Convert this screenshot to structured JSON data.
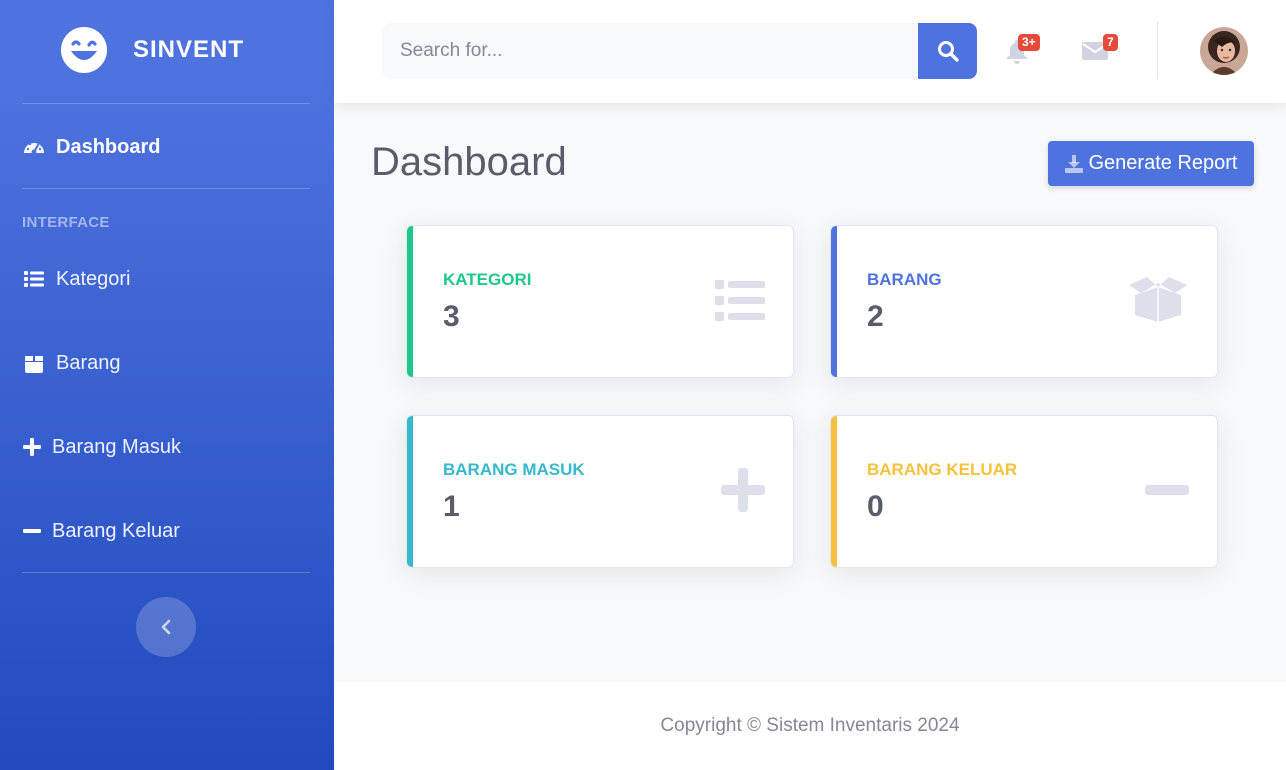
{
  "brand": {
    "name": "SINVENT"
  },
  "sidebar": {
    "active_item": {
      "label": "Dashboard",
      "icon": "tachometer-icon"
    },
    "heading": "INTERFACE",
    "items": [
      {
        "label": "Kategori",
        "icon": "list-icon"
      },
      {
        "label": "Barang",
        "icon": "box-icon"
      },
      {
        "label": "Barang Masuk",
        "icon": "plus-icon"
      },
      {
        "label": "Barang Keluar",
        "icon": "minus-icon"
      }
    ],
    "toggle_icon": "chevron-left-icon"
  },
  "topbar": {
    "search": {
      "placeholder": "Search for..."
    },
    "alerts": {
      "badge": "3+"
    },
    "messages": {
      "badge": "7"
    }
  },
  "main": {
    "title": "Dashboard",
    "report_button": "Generate Report",
    "cards": [
      {
        "label": "KATEGORI",
        "value": "3",
        "color": "#1cc88a",
        "icon": "list-icon"
      },
      {
        "label": "BARANG",
        "value": "2",
        "color": "#4e73df",
        "icon": "box-open-icon"
      },
      {
        "label": "BARANG MASUK",
        "value": "1",
        "color": "#36b9cc",
        "icon": "plus-icon"
      },
      {
        "label": "BARANG KELUAR",
        "value": "0",
        "color": "#f6c23e",
        "icon": "minus-icon"
      }
    ]
  },
  "footer": {
    "text": "Copyright © Sistem Inventaris 2024"
  },
  "colors": {
    "primary": "#4e73df",
    "danger": "#e74a3b",
    "icon_muted": "#dddfeb"
  }
}
